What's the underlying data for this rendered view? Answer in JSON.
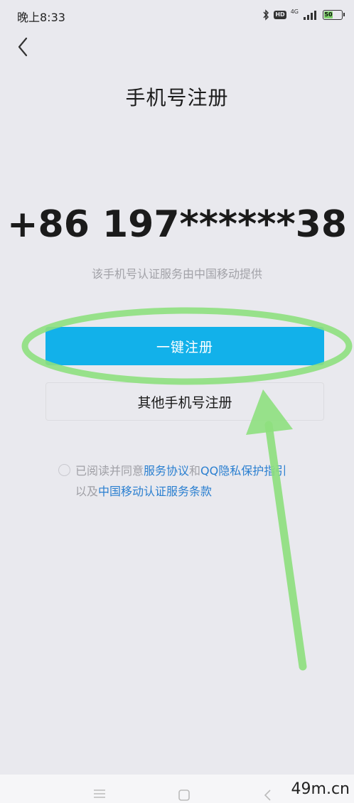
{
  "status_bar": {
    "time": "晚上8:33",
    "hd_badge": "HD",
    "network": "4G",
    "battery": "50",
    "battery_level": 0.5,
    "battery_color": "#7ed36a"
  },
  "header": {
    "title": "手机号注册"
  },
  "main": {
    "phone_number": "+86 197******38",
    "carrier_note": "该手机号认证服务由中国移动提供",
    "primary_button": "一键注册",
    "secondary_button": "其他手机号注册",
    "primary_color": "#12b1ea"
  },
  "agreement": {
    "prefix": "已阅读并同意",
    "service_link": "服务协议",
    "and": "和",
    "privacy_link": "QQ隐私保护指引",
    "also": "以及",
    "carrier_link": "中国移动认证服务条款",
    "link_color": "#2a7fd0"
  },
  "watermark": "49m.cn"
}
